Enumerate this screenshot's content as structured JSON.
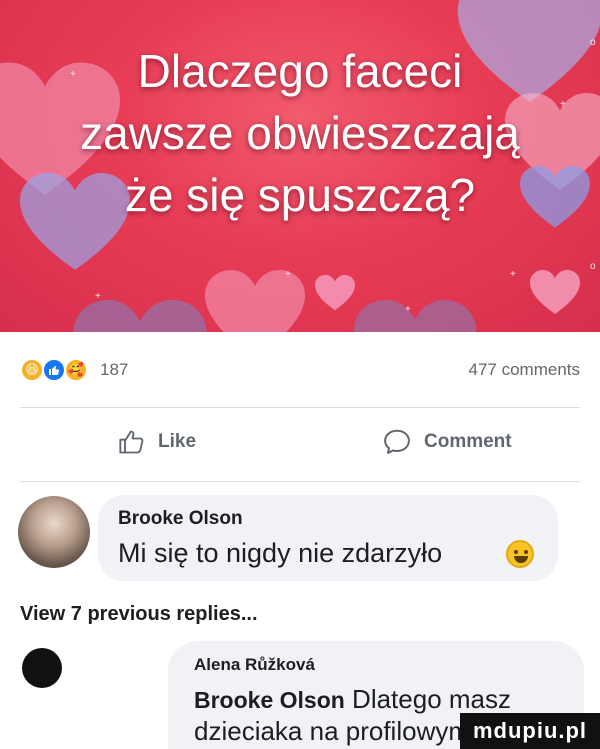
{
  "banner": {
    "title_lines": [
      "Dlaczego faceci",
      "zawsze obwieszczają",
      "że się spuszczą?"
    ],
    "background_color": "#e73c55"
  },
  "reactions": {
    "icons": [
      "haha-icon",
      "like-icon",
      "care-icon"
    ],
    "count": "187",
    "comments_count": "477 comments"
  },
  "actions": {
    "like_label": "Like",
    "comment_label": "Comment"
  },
  "comments": [
    {
      "author": "Brooke Olson",
      "text": "Mi się to nigdy nie zdarzyło",
      "emoji": "smile-emoji"
    }
  ],
  "view_replies": "View 7 previous replies...",
  "reply": {
    "author": "Alena Růžková",
    "mention": "Brooke Olson",
    "text_line1": "Dlatego masz",
    "text_line2": "dzieciaka na profilowym"
  },
  "watermark": "mdupiu.pl"
}
